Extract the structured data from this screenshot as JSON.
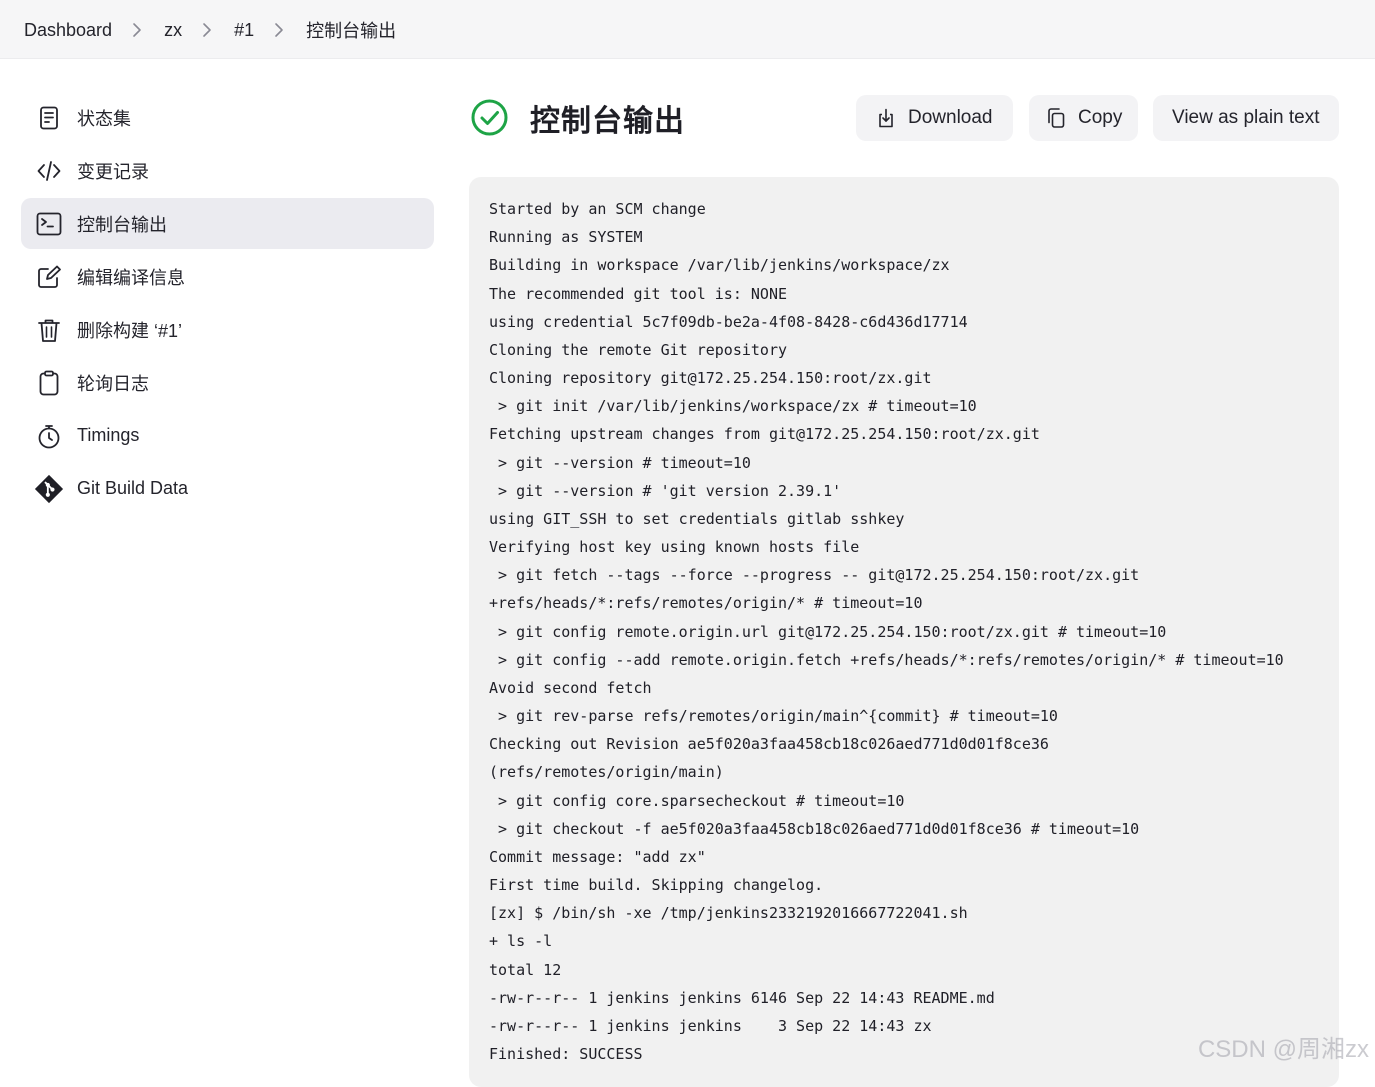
{
  "breadcrumb": [
    "Dashboard",
    "zx",
    "#1",
    "控制台输出"
  ],
  "sidebar": {
    "items": [
      {
        "label": "状态集",
        "icon": "document-icon"
      },
      {
        "label": "变更记录",
        "icon": "code-icon"
      },
      {
        "label": "控制台输出",
        "icon": "terminal-icon",
        "active": true
      },
      {
        "label": "编辑编译信息",
        "icon": "edit-icon"
      },
      {
        "label": "删除构建 ‘#1’",
        "icon": "trash-icon"
      },
      {
        "label": "轮询日志",
        "icon": "clipboard-icon"
      },
      {
        "label": "Timings",
        "icon": "stopwatch-icon"
      },
      {
        "label": "Git Build Data",
        "icon": "git-icon"
      }
    ]
  },
  "main": {
    "title": "控制台输出",
    "status_icon": "success-check-icon",
    "status_color": "#1ea446",
    "buttons": {
      "download": "Download",
      "copy": "Copy",
      "plain": "View as plain text"
    },
    "console_lines": [
      "Started by an SCM change",
      "Running as SYSTEM",
      "Building in workspace /var/lib/jenkins/workspace/zx",
      "The recommended git tool is: NONE",
      "using credential 5c7f09db-be2a-4f08-8428-c6d436d17714",
      "Cloning the remote Git repository",
      "Cloning repository git@172.25.254.150:root/zx.git",
      " > git init /var/lib/jenkins/workspace/zx # timeout=10",
      "Fetching upstream changes from git@172.25.254.150:root/zx.git",
      " > git --version # timeout=10",
      " > git --version # 'git version 2.39.1'",
      "using GIT_SSH to set credentials gitlab sshkey",
      "Verifying host key using known hosts file",
      " > git fetch --tags --force --progress -- git@172.25.254.150:root/zx.git",
      "+refs/heads/*:refs/remotes/origin/* # timeout=10",
      " > git config remote.origin.url git@172.25.254.150:root/zx.git # timeout=10",
      " > git config --add remote.origin.fetch +refs/heads/*:refs/remotes/origin/* # timeout=10",
      "Avoid second fetch",
      " > git rev-parse refs/remotes/origin/main^{commit} # timeout=10",
      "Checking out Revision ae5f020a3faa458cb18c026aed771d0d01f8ce36",
      "(refs/remotes/origin/main)",
      " > git config core.sparsecheckout # timeout=10",
      " > git checkout -f ae5f020a3faa458cb18c026aed771d0d01f8ce36 # timeout=10",
      "Commit message: \"add zx\"",
      "First time build. Skipping changelog.",
      "[zx] $ /bin/sh -xe /tmp/jenkins2332192016667722041.sh",
      "+ ls -l",
      "total 12",
      "-rw-r--r-- 1 jenkins jenkins 6146 Sep 22 14:43 README.md",
      "-rw-r--r-- 1 jenkins jenkins    3 Sep 22 14:43 zx",
      "Finished: SUCCESS"
    ]
  },
  "watermark": "CSDN @周湘zx"
}
